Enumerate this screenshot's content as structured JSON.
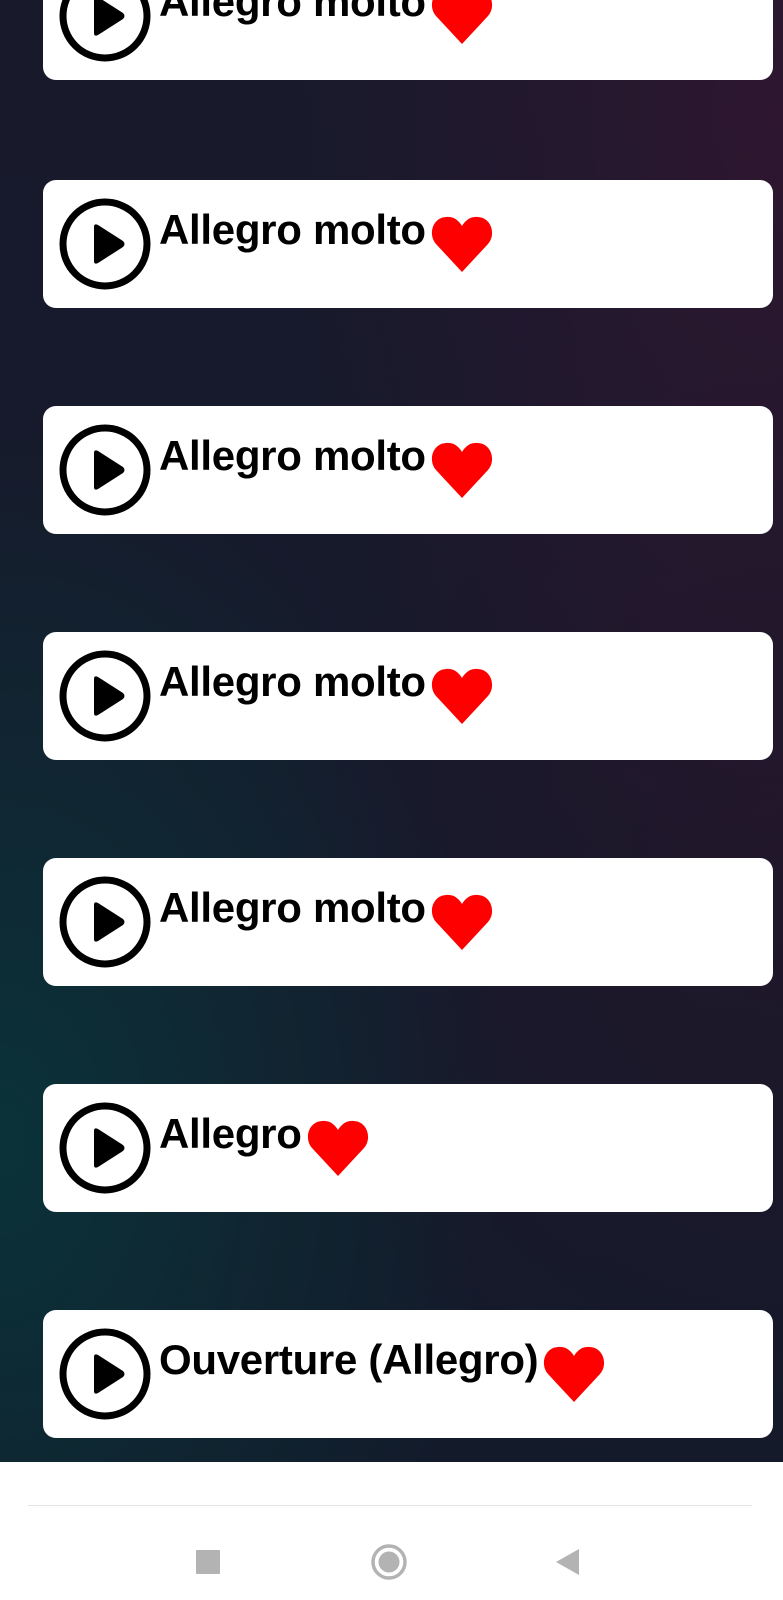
{
  "tracks": [
    {
      "title": "Allegro molto",
      "play_icon": "play-circle-icon",
      "favorite_icon": "heart-icon"
    },
    {
      "title": "Allegro molto",
      "play_icon": "play-circle-icon",
      "favorite_icon": "heart-icon"
    },
    {
      "title": "Allegro molto",
      "play_icon": "play-circle-icon",
      "favorite_icon": "heart-icon"
    },
    {
      "title": "Allegro molto",
      "play_icon": "play-circle-icon",
      "favorite_icon": "heart-icon"
    },
    {
      "title": "Allegro molto",
      "play_icon": "play-circle-icon",
      "favorite_icon": "heart-icon"
    },
    {
      "title": "Allegro",
      "play_icon": "play-circle-icon",
      "favorite_icon": "heart-icon"
    },
    {
      "title": "Ouverture (Allegro)",
      "play_icon": "play-circle-icon",
      "favorite_icon": "heart-icon"
    }
  ],
  "navigation_bar": {
    "buttons": [
      {
        "name": "recents-button",
        "icon": "square-icon"
      },
      {
        "name": "home-button",
        "icon": "circle-icon"
      },
      {
        "name": "back-button",
        "icon": "triangle-back-icon"
      }
    ]
  },
  "colors": {
    "heart": "#ff0000",
    "card_background": "#ffffff",
    "text": "#000000",
    "nav_icon": "#b3b3b3"
  }
}
